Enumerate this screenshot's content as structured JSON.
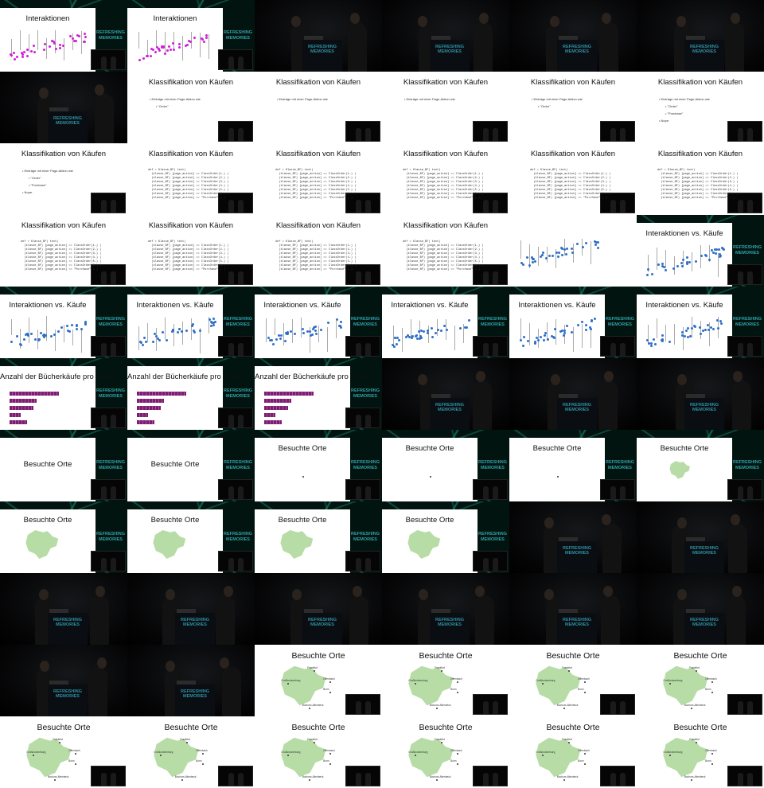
{
  "titles": {
    "interaktionen": "Interaktionen",
    "klassifikation": "Klassifikation von Käufen",
    "interaktionen_kaeufe": "Interaktionen vs. Käufe",
    "buecherkaeufe": "Anzahl der Bücherkäufe pro Monat",
    "besuchte_orte": "Besuchte Orte"
  },
  "logo_text": "REFRESHING\nMEMORIES",
  "bullets": {
    "eintraege": "Einträge mit einer Page-Aktion wie",
    "order": "\"Order\"",
    "purchase": "\"Purchase\"",
    "nope": "Nope."
  },
  "code_lines": [
    "def = Klasse_BF( text)",
    "  (klasse_BF) [page_action] == ClassOrder(1-) )",
    "  (klasse_BF) [page_action] == ClassOrder(2-) )",
    "  (klasse_BF) [page_action] == ClassOrder(3-) )",
    "  (klasse_BF) [page_action] == ClassOrder(4-) )",
    "  (klasse_BF) [page_action] == ClassOrder(5-) )",
    "  (klasse_BF) [page_action] == ClassOrder(6-) )",
    "  (klasse_BF) [page_action] == \"Purchase\" ) )"
  ],
  "map_labels": [
    "Großkrotzenburg",
    "Frankfurt",
    "Offenbach",
    "Bonn",
    "Bochum-Altenbeck"
  ],
  "colors": {
    "magenta": "#d020d8",
    "blue": "#2f6fc9",
    "bar": "#7a1f6e",
    "map": "#b7dca6"
  },
  "tiles": [
    {
      "kind": "slide-net",
      "title": "interaktionen",
      "content": "scatter-magenta",
      "inset": true
    },
    {
      "kind": "slide-net",
      "title": "interaktionen",
      "content": "scatter-magenta",
      "inset": true
    },
    {
      "kind": "stage"
    },
    {
      "kind": "stage"
    },
    {
      "kind": "stage"
    },
    {
      "kind": "stage"
    },
    {
      "kind": "stage"
    },
    {
      "kind": "slide",
      "title": "klassifikation",
      "content": "blank"
    },
    {
      "kind": "slide",
      "title": "klassifikation",
      "content": "b1"
    },
    {
      "kind": "slide",
      "title": "klassifikation",
      "content": "b1"
    },
    {
      "kind": "slide",
      "title": "klassifikation",
      "content": "b2"
    },
    {
      "kind": "slide",
      "title": "klassifikation",
      "content": "b4"
    },
    {
      "kind": "slide",
      "title": "klassifikation",
      "content": "b4"
    },
    {
      "kind": "slide",
      "title": "klassifikation",
      "content": "code"
    },
    {
      "kind": "slide",
      "title": "klassifikation",
      "content": "code"
    },
    {
      "kind": "slide",
      "title": "klassifikation",
      "content": "code"
    },
    {
      "kind": "slide",
      "title": "klassifikation",
      "content": "code"
    },
    {
      "kind": "slide",
      "title": "klassifikation",
      "content": "code"
    },
    {
      "kind": "slide",
      "title": "klassifikation",
      "content": "code"
    },
    {
      "kind": "slide",
      "title": "klassifikation",
      "content": "code"
    },
    {
      "kind": "slide",
      "title": "klassifikation",
      "content": "code"
    },
    {
      "kind": "slide",
      "title": "klassifikation",
      "content": "code"
    },
    {
      "kind": "slide",
      "title": "",
      "content": "scatter-blue",
      "nocam": true
    },
    {
      "kind": "slide-net",
      "title": "interaktionen_kaeufe",
      "content": "scatter-blue",
      "inset": true
    },
    {
      "kind": "slide-net",
      "title": "interaktionen_kaeufe",
      "content": "scatter-blue",
      "inset": true
    },
    {
      "kind": "slide-net",
      "title": "interaktionen_kaeufe",
      "content": "scatter-blue",
      "inset": true
    },
    {
      "kind": "slide-net",
      "title": "interaktionen_kaeufe",
      "content": "scatter-blue",
      "inset": true
    },
    {
      "kind": "slide-net",
      "title": "interaktionen_kaeufe",
      "content": "scatter-blue",
      "inset": true
    },
    {
      "kind": "slide-net",
      "title": "interaktionen_kaeufe",
      "content": "scatter-blue",
      "inset": true
    },
    {
      "kind": "slide-net",
      "title": "interaktionen_kaeufe",
      "content": "scatter-blue",
      "inset": true
    },
    {
      "kind": "slide-net",
      "title": "buecherkaeufe",
      "content": "bars",
      "inset": true
    },
    {
      "kind": "slide-net",
      "title": "buecherkaeufe",
      "content": "bars",
      "inset": true
    },
    {
      "kind": "slide-net",
      "title": "buecherkaeufe",
      "content": "bars",
      "inset": true
    },
    {
      "kind": "stage"
    },
    {
      "kind": "stage"
    },
    {
      "kind": "stage"
    },
    {
      "kind": "slide-net",
      "title": "besuchte_orte",
      "content": "mid-title",
      "inset": true
    },
    {
      "kind": "slide-net",
      "title": "besuchte_orte",
      "content": "mid-title",
      "inset": true
    },
    {
      "kind": "slide-net",
      "title": "besuchte_orte",
      "content": "tiny-map",
      "inset": true
    },
    {
      "kind": "slide-net",
      "title": "besuchte_orte",
      "content": "tiny-map",
      "inset": true
    },
    {
      "kind": "slide-net",
      "title": "besuchte_orte",
      "content": "tiny-map",
      "inset": true
    },
    {
      "kind": "slide-net",
      "title": "besuchte_orte",
      "content": "small-map",
      "inset": true
    },
    {
      "kind": "slide-net",
      "title": "besuchte_orte",
      "content": "map",
      "inset": true
    },
    {
      "kind": "slide-net",
      "title": "besuchte_orte",
      "content": "map",
      "inset": true
    },
    {
      "kind": "slide-net",
      "title": "besuchte_orte",
      "content": "map",
      "inset": true
    },
    {
      "kind": "slide-net",
      "title": "besuchte_orte",
      "content": "map",
      "inset": true
    },
    {
      "kind": "stage"
    },
    {
      "kind": "stage"
    },
    {
      "kind": "stage"
    },
    {
      "kind": "stage"
    },
    {
      "kind": "stage"
    },
    {
      "kind": "stage"
    },
    {
      "kind": "stage"
    },
    {
      "kind": "stage"
    },
    {
      "kind": "stage"
    },
    {
      "kind": "stage"
    },
    {
      "kind": "slide",
      "title": "besuchte_orte",
      "content": "map-big",
      "big": true
    },
    {
      "kind": "slide",
      "title": "besuchte_orte",
      "content": "map-big",
      "big": true
    },
    {
      "kind": "slide",
      "title": "besuchte_orte",
      "content": "map-big",
      "big": true
    },
    {
      "kind": "slide",
      "title": "besuchte_orte",
      "content": "map-big",
      "big": true
    },
    {
      "kind": "slide",
      "title": "besuchte_orte",
      "content": "map-big",
      "big": true
    },
    {
      "kind": "slide",
      "title": "besuchte_orte",
      "content": "map-big",
      "big": true
    },
    {
      "kind": "slide",
      "title": "besuchte_orte",
      "content": "map-big",
      "big": true
    },
    {
      "kind": "slide",
      "title": "besuchte_orte",
      "content": "map-big",
      "big": true
    },
    {
      "kind": "slide",
      "title": "besuchte_orte",
      "content": "map-big",
      "big": true
    },
    {
      "kind": "slide",
      "title": "besuchte_orte",
      "content": "map-big",
      "big": true
    }
  ]
}
